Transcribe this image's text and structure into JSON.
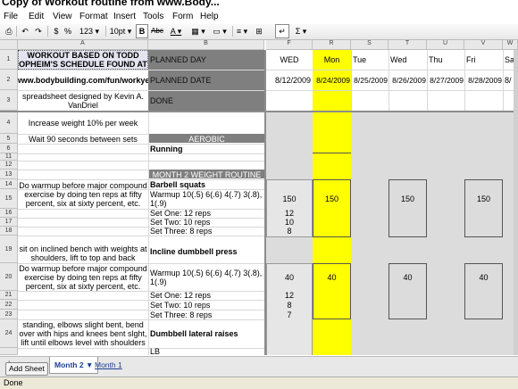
{
  "window": {
    "title": "Copy of Workout routine from www.Body..."
  },
  "menu": [
    "File",
    "Edit",
    "View",
    "Format",
    "Insert",
    "Tools",
    "Form",
    "Help"
  ],
  "toolbar": {
    "currency": "$",
    "percent": "%",
    "number_format": "123",
    "font_size": "10pt",
    "bold": "B",
    "strike": "Abc",
    "text_color": "A",
    "sum": "Σ"
  },
  "columns": {
    "a": "A",
    "b": "B",
    "f": "F",
    "r": "R",
    "s": "S",
    "t": "T",
    "u": "U",
    "v": "V",
    "w": "W"
  },
  "rows": {
    "r1": "1",
    "r2": "2",
    "r3": "3",
    "r4": "4",
    "r5": "5",
    "r6": "6",
    "r11": "11",
    "r12": "12",
    "r13": "13",
    "r14": "14",
    "r15": "15",
    "r16": "16",
    "r17": "17",
    "r18": "18",
    "r19": "19",
    "r20": "20",
    "r21": "21",
    "r22": "22",
    "r23": "23",
    "r24": "24"
  },
  "colA": {
    "r1": "WORKOUT BASED ON TODD OPHEIM'S SCHEDULE FOUND AT",
    "r2": "http://www.bodybuilding.com/fun/workyear.htm",
    "r3": "spreadsheet designed by Kevin A. VanDriel",
    "r4": "Increase weight 10% per week",
    "r5": "Wait 90 seconds between sets",
    "r15": "Do warmup before major compound exercise by doing ten reps at fifty percent, six at sixty percent, etc.",
    "r19": "sit on inclined bench with weights at shoulders, lift to top and back",
    "r20": "Do warmup before major compound exercise by doing ten reps at fifty percent, six at sixty percent, etc.",
    "r24": "standing, elbows slight bent, bend over with hips and knees bent slght, lift until elbows level with shoulders"
  },
  "colB": {
    "r1": "PLANNED DAY",
    "r2": "PLANNED DATE",
    "r3": "DONE",
    "r5": "AEROBIC",
    "r6": "Running",
    "r13": "MONTH 2 WEIGHT ROUTINE",
    "r14": "Barbell squats",
    "r15": "Warmup 10(.5) 6(.6) 4(.7) 3(.8), 1(.9)",
    "r16": "Set One: 12 reps",
    "r17": "Set Two: 10 reps",
    "r18": "Set Three: 8 reps",
    "r19": "Incline dumbbell press",
    "r20": "Warmup 10(.5) 6(.6) 4(.7) 3(.8), 1(.9)",
    "r21": "Set One: 12 reps",
    "r22": "Set Two: 10 reps",
    "r23": "Set Three: 8 reps",
    "r24": "Dumbbell lateral raises",
    "r25": "LB"
  },
  "days": {
    "f": "WED",
    "r": "Mon",
    "s": "Tue",
    "t": "Wed",
    "u": "Thu",
    "v": "Fri",
    "w": "Sat"
  },
  "dates": {
    "f": "8/12/2009",
    "r": "8/24/2009",
    "s": "8/25/2009",
    "t": "8/26/2009",
    "u": "8/27/2009",
    "v": "8/28/2009",
    "w": "8/"
  },
  "values": {
    "f15": "150",
    "r15": "150",
    "t15": "150",
    "v15": "150",
    "f16": "12",
    "f17": "10",
    "f18": "8",
    "f20": "40",
    "r20": "40",
    "t20": "40",
    "v20": "40",
    "f21": "12",
    "f22": "8",
    "f23": "7"
  },
  "tabs": {
    "add_sheet": "Add Sheet",
    "active": "Month 2 ▼",
    "other": "Month 1"
  },
  "status": "Done",
  "colors": {
    "yellow": "#ffff00",
    "dark_header": "#7f7f7f",
    "grey_fill": "#dcdcdc"
  }
}
